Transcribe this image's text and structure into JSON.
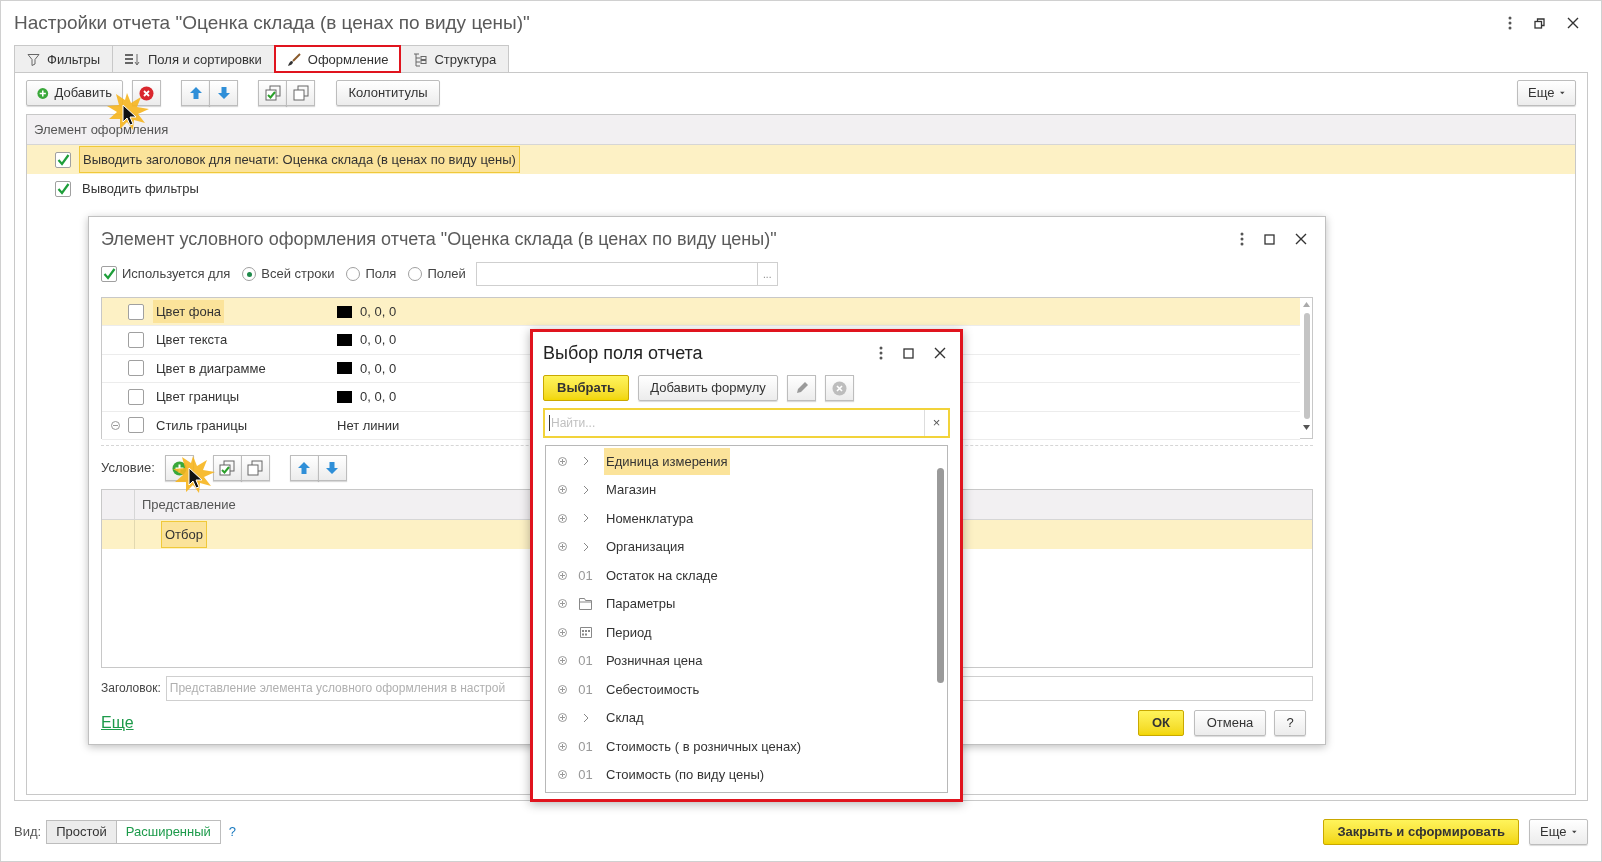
{
  "window": {
    "title": "Настройки отчета \"Оценка склада (в ценах по виду цены)\""
  },
  "tabs": [
    {
      "label": "Фильтры",
      "kind": "filter",
      "selected": false,
      "highlighted": false
    },
    {
      "label": "Поля и сортировки",
      "kind": "fields",
      "selected": false,
      "highlighted": false
    },
    {
      "label": "Оформление",
      "kind": "brush",
      "selected": true,
      "highlighted": true
    },
    {
      "label": "Структура",
      "kind": "structure",
      "selected": false,
      "highlighted": false
    }
  ],
  "toolbar": {
    "add_button": "Добавить",
    "headers_button": "Колонтитулы",
    "more_button": "Еще"
  },
  "elements_table": {
    "column": "Элемент оформления",
    "rows": [
      {
        "text": "Выводить заголовок для печати: Оценка склада (в ценах по виду цены)",
        "checked": true,
        "selected": true
      },
      {
        "text": "Выводить фильтры",
        "checked": true,
        "selected": false
      }
    ]
  },
  "element_dialog": {
    "title": "Элемент условного оформления отчета \"Оценка склада (в ценах по виду цены)\"",
    "used_for": {
      "label": "Используется для",
      "checked": true
    },
    "scope": [
      {
        "label": "Всей строки",
        "selected": true
      },
      {
        "label": "Поля",
        "selected": false
      },
      {
        "label": "Полей",
        "selected": false
      }
    ],
    "scope_button": "...",
    "properties": [
      {
        "kind": "color",
        "name": "Цвет фона",
        "checked": false,
        "selected": true,
        "color": "#000000",
        "value": "0, 0, 0"
      },
      {
        "kind": "color",
        "name": "Цвет текста",
        "checked": false,
        "selected": false,
        "color": "#000000",
        "value": "0, 0, 0"
      },
      {
        "kind": "color",
        "name": "Цвет в диаграмме",
        "checked": false,
        "selected": false,
        "color": "#000000",
        "value": "0, 0, 0"
      },
      {
        "kind": "color",
        "name": "Цвет границы",
        "checked": false,
        "selected": false,
        "color": "#000000",
        "value": "0, 0, 0"
      },
      {
        "kind": "style",
        "name": "Стиль границы",
        "checked": false,
        "selected": false,
        "expanded": true,
        "value": "Нет линии"
      }
    ],
    "condition_label": "Условие:",
    "condition_table": {
      "column": "Представление",
      "rows": [
        {
          "text": "Отбор",
          "selected": true
        }
      ]
    },
    "heading_label": "Заголовок:",
    "heading_placeholder": "Представление элемента условного оформления в настрой",
    "more_link": "Еще",
    "ok_button": "ОК",
    "cancel_button": "Отмена",
    "help_button": "?"
  },
  "field_chooser": {
    "title": "Выбор поля отчета",
    "highlighted": true,
    "select_button": "Выбрать",
    "formula_button": "Добавить формулу",
    "search_placeholder": "Найти...",
    "clear_button": "×",
    "items": [
      {
        "kind": "group",
        "label": "Единица измерения",
        "selected": true
      },
      {
        "kind": "group",
        "label": "Магазин",
        "selected": false
      },
      {
        "kind": "group",
        "label": "Номенклатура",
        "selected": false
      },
      {
        "kind": "group",
        "label": "Организация",
        "selected": false
      },
      {
        "kind": "number",
        "marker": "01",
        "label": "Остаток на складе",
        "selected": false
      },
      {
        "kind": "folder",
        "label": "Параметры",
        "selected": false
      },
      {
        "kind": "date",
        "label": "Период",
        "selected": false
      },
      {
        "kind": "number",
        "marker": "01",
        "label": "Розничная цена",
        "selected": false
      },
      {
        "kind": "number",
        "marker": "01",
        "label": "Себестоимость",
        "selected": false
      },
      {
        "kind": "group",
        "label": "Склад",
        "selected": false
      },
      {
        "kind": "number",
        "marker": "01",
        "label": "Стоимость ( в розничных ценах)",
        "selected": false
      },
      {
        "kind": "number",
        "marker": "01",
        "label": "Стоимость (по виду цены)",
        "selected": false
      }
    ]
  },
  "bottom_bar": {
    "view_label": "Вид:",
    "view_options": [
      {
        "label": "Простой",
        "selected": false
      },
      {
        "label": "Расширенный",
        "selected": true
      }
    ],
    "help": "?",
    "primary_button": "Закрыть и сформировать",
    "more_button": "Еще"
  }
}
